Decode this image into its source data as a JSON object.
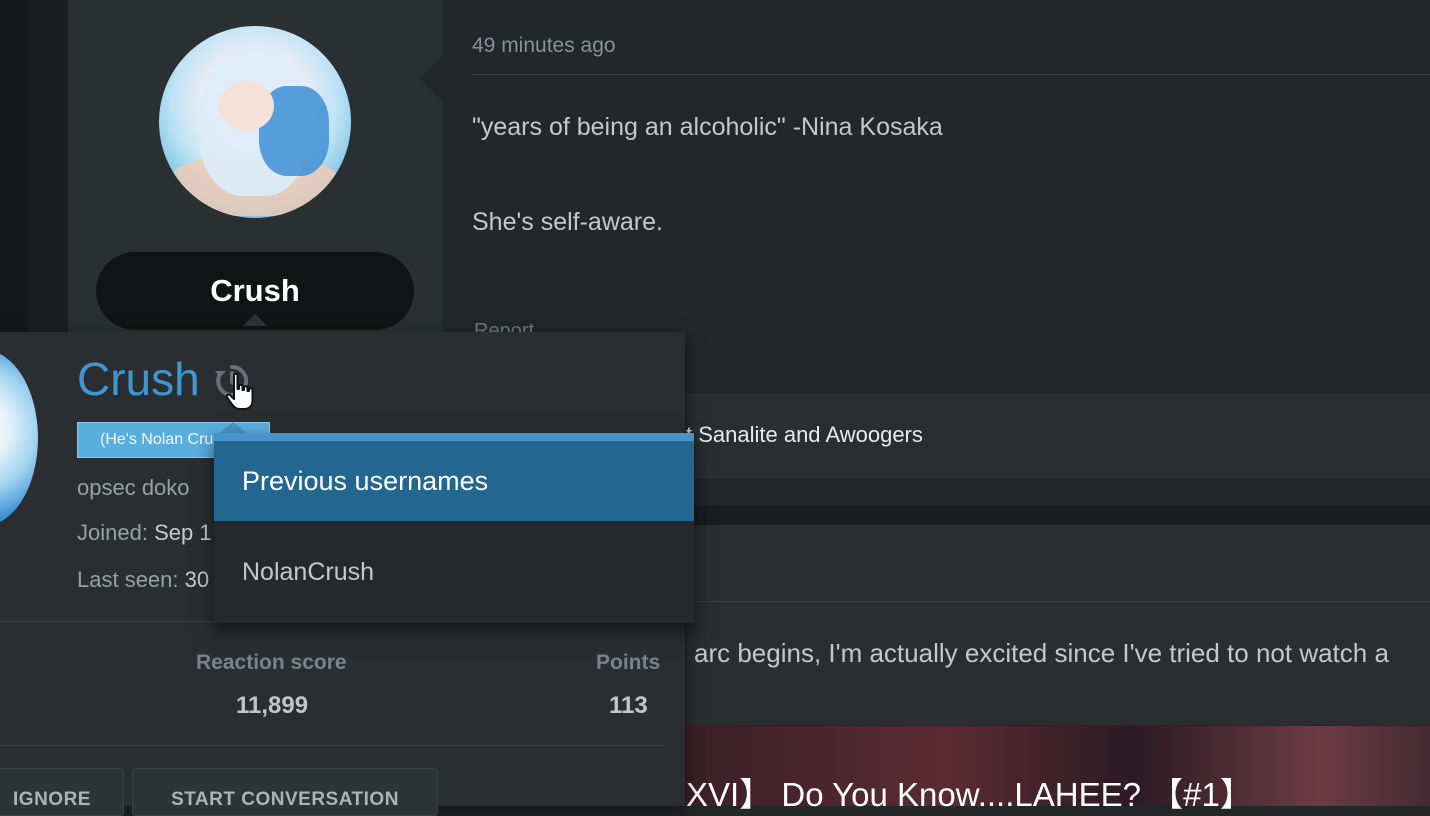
{
  "post": {
    "time": "49 minutes ago",
    "line1": "\"years of being an alcoholic\" -Nina Kosaka",
    "line2": "She's self-aware.",
    "report_label": "Report",
    "signature": "t Sanalite and Awoogers"
  },
  "user": {
    "name": "Crush"
  },
  "post2": {
    "text": "arc begins, I'm actually excited since I've tried to not watch a",
    "embed_title": "XVI】 Do You Know....LAHEE? 【#1】"
  },
  "card": {
    "name": "Crush",
    "title_badge": "(He's Nolan Crush)",
    "custom_title": "opsec doko",
    "joined_label": "Joined:",
    "joined_value": "Sep 1",
    "last_seen_label": "Last seen:",
    "last_seen_value": "30",
    "reaction_label": "Reaction score",
    "reaction_value": "11,899",
    "points_label": "Points",
    "points_value": "113",
    "ignore_button": "IGNORE",
    "conversation_button": "START CONVERSATION",
    "accent_color": "#3e97d1",
    "badge_color": "#5aaede"
  },
  "tooltip": {
    "title": "Previous usernames",
    "usernames": [
      "NolanCrush"
    ],
    "header_color": "#23668f"
  },
  "icons": {
    "history": "history-icon",
    "pointer": "hand-pointer-icon"
  }
}
